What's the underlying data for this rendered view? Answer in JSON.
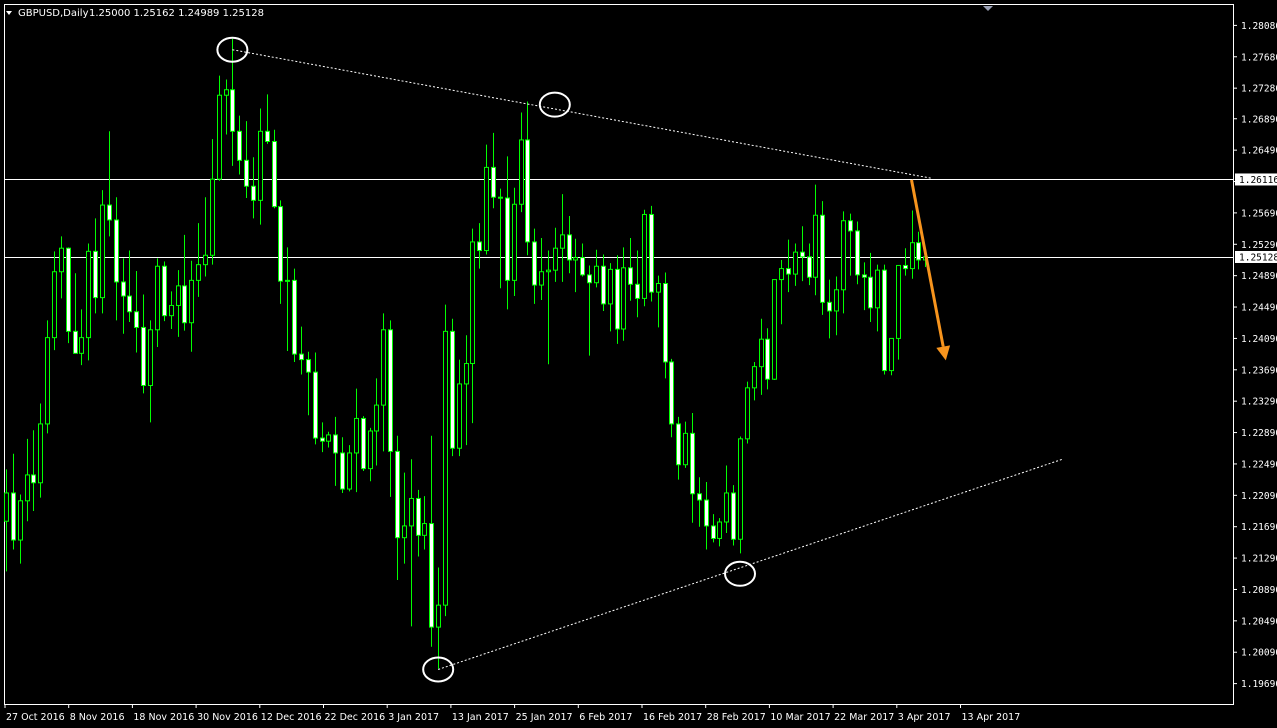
{
  "header": {
    "symbol": "GBPUSD,Daily",
    "ohlc": "1.25000 1.25162 1.24989 1.25128"
  },
  "colors": {
    "background": "#000000",
    "candle_up_fill": "#000000",
    "candle_down_fill": "#FFFFFF",
    "candle_outline": "#00FF00",
    "wick": "#00FF00",
    "axis_text": "#FFFFFF",
    "trendline": "#FFFFFF",
    "arrow": "#F7941D",
    "hline": "#FFFFFF"
  },
  "chart_data": {
    "type": "candlestick",
    "title": "GBPUSD,Daily",
    "ylim": [
      1.1943,
      1.2834
    ],
    "y_ticks": [
      "1.28080",
      "1.27680",
      "1.27280",
      "1.26890",
      "1.26490",
      "1.26090",
      "1.25690",
      "1.25290",
      "1.24890",
      "1.24490",
      "1.24090",
      "1.23690",
      "1.23290",
      "1.22890",
      "1.22490",
      "1.22090",
      "1.21690",
      "1.21290",
      "1.20890",
      "1.20490",
      "1.20090",
      "1.19690"
    ],
    "x_ticks": [
      "27 Oct 2016",
      "8 Nov 2016",
      "18 Nov 2016",
      "30 Nov 2016",
      "12 Dec 2016",
      "22 Dec 2016",
      "3 Jan 2017",
      "13 Jan 2017",
      "25 Jan 2017",
      "6 Feb 2017",
      "16 Feb 2017",
      "28 Feb 2017",
      "10 Mar 2017",
      "22 Mar 2017",
      "3 Apr 2017",
      "13 Apr 2017"
    ],
    "price_labels": [
      {
        "value": 1.26116,
        "label": "1.26116"
      },
      {
        "value": 1.25128,
        "label": "1.25128"
      }
    ],
    "candles": [
      [
        1.2176,
        1.2242,
        1.2112,
        1.2212
      ],
      [
        1.2212,
        1.2262,
        1.214,
        1.2152
      ],
      [
        1.2152,
        1.221,
        1.2122,
        1.2202
      ],
      [
        1.2202,
        1.2281,
        1.2176,
        1.2235
      ],
      [
        1.2235,
        1.2292,
        1.2189,
        1.2225
      ],
      [
        1.2225,
        1.2326,
        1.2206,
        1.23
      ],
      [
        1.23,
        1.2432,
        1.2288,
        1.241
      ],
      [
        1.241,
        1.252,
        1.2394,
        1.2494
      ],
      [
        1.2494,
        1.2539,
        1.246,
        1.2524
      ],
      [
        1.2524,
        1.2525,
        1.2403,
        1.2418
      ],
      [
        1.2418,
        1.2492,
        1.239,
        1.239
      ],
      [
        1.239,
        1.2446,
        1.2375,
        1.241
      ],
      [
        1.241,
        1.253,
        1.2381,
        1.252
      ],
      [
        1.252,
        1.2562,
        1.2441,
        1.2461
      ],
      [
        1.2461,
        1.2598,
        1.2441,
        1.2579
      ],
      [
        1.2579,
        1.2673,
        1.2539,
        1.256
      ],
      [
        1.256,
        1.2589,
        1.2432,
        1.2481
      ],
      [
        1.2481,
        1.2511,
        1.2415,
        1.2463
      ],
      [
        1.2463,
        1.2521,
        1.243,
        1.2443
      ],
      [
        1.2443,
        1.2495,
        1.2391,
        1.2423
      ],
      [
        1.2423,
        1.2465,
        1.2339,
        1.2349
      ],
      [
        1.2349,
        1.2432,
        1.2302,
        1.242
      ],
      [
        1.242,
        1.2511,
        1.2398,
        1.2501
      ],
      [
        1.2501,
        1.2507,
        1.2431,
        1.2438
      ],
      [
        1.2438,
        1.2469,
        1.2421,
        1.2451
      ],
      [
        1.2451,
        1.2496,
        1.2411,
        1.2476
      ],
      [
        1.2476,
        1.2541,
        1.2419,
        1.2429
      ],
      [
        1.2429,
        1.2508,
        1.2392,
        1.2483
      ],
      [
        1.2483,
        1.2556,
        1.2462,
        1.2503
      ],
      [
        1.2503,
        1.2589,
        1.2488,
        1.2515
      ],
      [
        1.2515,
        1.2663,
        1.2503,
        1.2612
      ],
      [
        1.2612,
        1.2744,
        1.261,
        1.2719
      ],
      [
        1.2719,
        1.2739,
        1.2669,
        1.2726
      ],
      [
        1.2726,
        1.2791,
        1.2629,
        1.2673
      ],
      [
        1.2673,
        1.2693,
        1.2618,
        1.2636
      ],
      [
        1.2636,
        1.2686,
        1.2588,
        1.2603
      ],
      [
        1.2603,
        1.264,
        1.2562,
        1.2585
      ],
      [
        1.2585,
        1.2702,
        1.2554,
        1.2673
      ],
      [
        1.2673,
        1.272,
        1.2657,
        1.266
      ],
      [
        1.266,
        1.2675,
        1.2575,
        1.2577
      ],
      [
        1.2577,
        1.2585,
        1.2453,
        1.2482
      ],
      [
        1.2482,
        1.2525,
        1.2393,
        1.2483
      ],
      [
        1.2483,
        1.2498,
        1.2379,
        1.2389
      ],
      [
        1.2389,
        1.2424,
        1.2363,
        1.2382
      ],
      [
        1.2382,
        1.2392,
        1.2311,
        1.2366
      ],
      [
        1.2366,
        1.2391,
        1.2274,
        1.2282
      ],
      [
        1.2282,
        1.2302,
        1.2264,
        1.2278
      ],
      [
        1.2278,
        1.229,
        1.227,
        1.2286
      ],
      [
        1.2286,
        1.2309,
        1.2221,
        1.2263
      ],
      [
        1.2263,
        1.2283,
        1.2212,
        1.2217
      ],
      [
        1.2217,
        1.2273,
        1.2214,
        1.2263
      ],
      [
        1.2263,
        1.2345,
        1.2213,
        1.2307
      ],
      [
        1.2307,
        1.231,
        1.224,
        1.2243
      ],
      [
        1.2243,
        1.2295,
        1.2227,
        1.2291
      ],
      [
        1.2291,
        1.2358,
        1.2247,
        1.2324
      ],
      [
        1.2324,
        1.2441,
        1.2265,
        1.242
      ],
      [
        1.242,
        1.2432,
        1.2207,
        1.2265
      ],
      [
        1.2265,
        1.2285,
        1.2101,
        1.2155
      ],
      [
        1.2155,
        1.2238,
        1.2122,
        1.217
      ],
      [
        1.217,
        1.2255,
        1.2042,
        1.2205
      ],
      [
        1.2205,
        1.2216,
        1.2131,
        1.2158
      ],
      [
        1.2158,
        1.2208,
        1.214,
        1.2173
      ],
      [
        1.2173,
        1.2285,
        1.2016,
        1.2041
      ],
      [
        1.2041,
        1.2117,
        1.1988,
        1.2069
      ],
      [
        1.2069,
        1.2452,
        1.2055,
        1.2418
      ],
      [
        1.2418,
        1.2434,
        1.2259,
        1.2269
      ],
      [
        1.2269,
        1.2382,
        1.2259,
        1.2351
      ],
      [
        1.2351,
        1.2413,
        1.2273,
        1.2377
      ],
      [
        1.2377,
        1.2549,
        1.2301,
        1.2532
      ],
      [
        1.2532,
        1.2556,
        1.2498,
        1.2521
      ],
      [
        1.2521,
        1.2656,
        1.2516,
        1.2627
      ],
      [
        1.2627,
        1.2671,
        1.2575,
        1.2589
      ],
      [
        1.2589,
        1.26,
        1.2473,
        1.2588
      ],
      [
        1.2588,
        1.2641,
        1.2446,
        1.2483
      ],
      [
        1.2483,
        1.2601,
        1.2463,
        1.258
      ],
      [
        1.258,
        1.2697,
        1.257,
        1.2662
      ],
      [
        1.2662,
        1.2711,
        1.2515,
        1.2532
      ],
      [
        1.2532,
        1.2549,
        1.2453,
        1.2477
      ],
      [
        1.2477,
        1.2537,
        1.2458,
        1.2494
      ],
      [
        1.2494,
        1.2521,
        1.2376,
        1.2496
      ],
      [
        1.2496,
        1.255,
        1.2481,
        1.2524
      ],
      [
        1.2524,
        1.2593,
        1.2481,
        1.2541
      ],
      [
        1.2541,
        1.2565,
        1.2492,
        1.2509
      ],
      [
        1.2509,
        1.2536,
        1.2468,
        1.2512
      ],
      [
        1.2512,
        1.253,
        1.2488,
        1.249
      ],
      [
        1.249,
        1.2502,
        1.2387,
        1.248
      ],
      [
        1.248,
        1.2522,
        1.2474,
        1.2501
      ],
      [
        1.2501,
        1.2516,
        1.2444,
        1.2453
      ],
      [
        1.2453,
        1.2505,
        1.2418,
        1.2497
      ],
      [
        1.2497,
        1.2515,
        1.2402,
        1.2421
      ],
      [
        1.2421,
        1.2525,
        1.2406,
        1.2499
      ],
      [
        1.2499,
        1.2537,
        1.2457,
        1.2478
      ],
      [
        1.2478,
        1.2521,
        1.2436,
        1.246
      ],
      [
        1.246,
        1.2573,
        1.245,
        1.2567
      ],
      [
        1.2567,
        1.2578,
        1.2456,
        1.2468
      ],
      [
        1.2468,
        1.2489,
        1.2423,
        1.2479
      ],
      [
        1.2479,
        1.2493,
        1.2358,
        1.2379
      ],
      [
        1.2379,
        1.2383,
        1.2283,
        1.23
      ],
      [
        1.23,
        1.2309,
        1.2229,
        1.2248
      ],
      [
        1.2248,
        1.2303,
        1.2244,
        1.2288
      ],
      [
        1.2288,
        1.2314,
        1.2174,
        1.2211
      ],
      [
        1.2211,
        1.2232,
        1.2169,
        1.2203
      ],
      [
        1.2203,
        1.2226,
        1.214,
        1.217
      ],
      [
        1.217,
        1.2185,
        1.2149,
        1.2154
      ],
      [
        1.2154,
        1.218,
        1.2144,
        1.2175
      ],
      [
        1.2175,
        1.2247,
        1.2161,
        1.2212
      ],
      [
        1.2212,
        1.2222,
        1.2145,
        1.2153
      ],
      [
        1.2153,
        1.2284,
        1.2135,
        1.2281
      ],
      [
        1.2281,
        1.2354,
        1.2275,
        1.2346
      ],
      [
        1.2346,
        1.2379,
        1.233,
        1.2373
      ],
      [
        1.2373,
        1.2434,
        1.2337,
        1.2408
      ],
      [
        1.2408,
        1.2422,
        1.2344,
        1.2357
      ],
      [
        1.2357,
        1.2469,
        1.2356,
        1.2484
      ],
      [
        1.2484,
        1.2509,
        1.2427,
        1.2498
      ],
      [
        1.2498,
        1.2535,
        1.2468,
        1.2491
      ],
      [
        1.2491,
        1.253,
        1.2476,
        1.2519
      ],
      [
        1.2519,
        1.2552,
        1.2482,
        1.2513
      ],
      [
        1.2513,
        1.253,
        1.2477,
        1.2487
      ],
      [
        1.2487,
        1.2605,
        1.2464,
        1.2566
      ],
      [
        1.2566,
        1.2584,
        1.2439,
        1.2455
      ],
      [
        1.2455,
        1.2484,
        1.2409,
        1.2444
      ],
      [
        1.2444,
        1.2488,
        1.2413,
        1.2471
      ],
      [
        1.2471,
        1.2571,
        1.2441,
        1.2559
      ],
      [
        1.2559,
        1.2568,
        1.2489,
        1.2546
      ],
      [
        1.2546,
        1.2558,
        1.2478,
        1.249
      ],
      [
        1.249,
        1.2506,
        1.2445,
        1.2487
      ],
      [
        1.2487,
        1.2518,
        1.243,
        1.2448
      ],
      [
        1.2448,
        1.2503,
        1.2418,
        1.2496
      ],
      [
        1.2496,
        1.2503,
        1.2363,
        1.2368
      ],
      [
        1.2368,
        1.2408,
        1.2362,
        1.2409
      ],
      [
        1.2409,
        1.2443,
        1.2382,
        1.2502
      ],
      [
        1.2502,
        1.2524,
        1.2489,
        1.2498
      ],
      [
        1.2498,
        1.2572,
        1.2485,
        1.2531
      ],
      [
        1.2531,
        1.2545,
        1.2497,
        1.2509
      ],
      [
        1.2509,
        1.2515,
        1.25,
        1.2513
      ]
    ],
    "annotations": [
      {
        "type": "trendline",
        "style": "dotted",
        "from": [
          33,
          1.2777
        ],
        "to": [
          135,
          1.2613
        ]
      },
      {
        "type": "trendline",
        "style": "dotted",
        "from": [
          63,
          1.1987
        ],
        "to": [
          154,
          1.2255
        ]
      },
      {
        "type": "hline",
        "value": 1.26116
      },
      {
        "type": "hline",
        "value": 1.25128
      },
      {
        "type": "circle",
        "at": [
          33,
          1.2777
        ]
      },
      {
        "type": "circle",
        "at": [
          80,
          1.2707
        ]
      },
      {
        "type": "circle",
        "at": [
          107,
          1.2109
        ]
      },
      {
        "type": "circle",
        "at": [
          63,
          1.1987
        ]
      },
      {
        "type": "arrow",
        "from": [
          132,
          1.2611
        ],
        "to": [
          137,
          1.2381
        ]
      }
    ]
  }
}
